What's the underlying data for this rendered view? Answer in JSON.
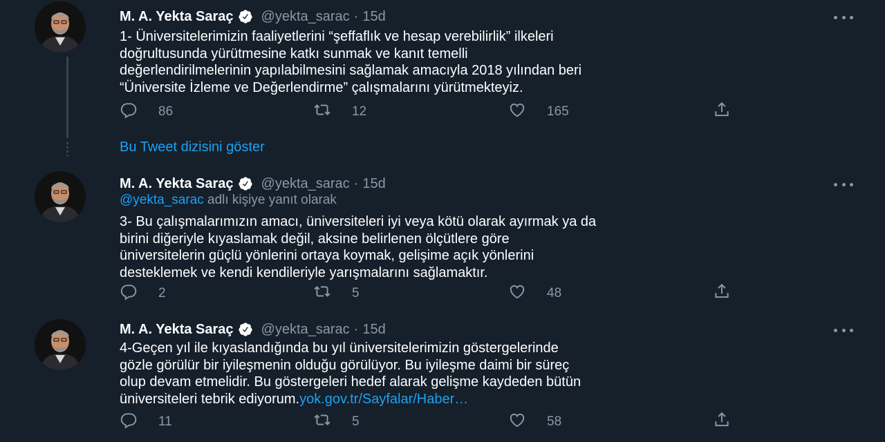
{
  "colors": {
    "background": "#15202b",
    "text": "#ffffff",
    "muted": "#8899a6",
    "accent": "#1da1f2",
    "thread_line": "#38444d"
  },
  "tweets": [
    {
      "name": "M. A. Yekta Saraç",
      "handle": "@yekta_sarac",
      "separator": "·",
      "time": "15d",
      "lines": [
        "1- Üniversitelerimizin faaliyetlerini “şeffaflık ve hesap verebilirlik” ilkeleri",
        "doğrultusunda yürütmesine katkı sunmak ve kanıt temelli",
        "değerlendirilmelerinin yapılabilmesini sağlamak amacıyla 2018 yılından beri",
        "“Üniversite İzleme ve Değerlendirme” çalışmalarını yürütmekteyiz."
      ],
      "replies": "86",
      "retweets": "12",
      "likes": "165"
    },
    {
      "name": "M. A. Yekta Saraç",
      "handle": "@yekta_sarac",
      "separator": "·",
      "time": "15d",
      "reply_mention": "@yekta_sarac",
      "reply_suffix": "adlı kişiye yanıt olarak",
      "lines": [
        "3- Bu çalışmalarımızın amacı, üniversiteleri iyi veya kötü olarak ayırmak ya da",
        "birini diğeriyle kıyaslamak değil, aksine belirlenen ölçütlere göre",
        "üniversitelerin güçlü yönlerini ortaya koymak, gelişime açık yönlerini",
        "desteklemek ve kendi kendileriyle yarışmalarını sağlamaktır."
      ],
      "replies": "2",
      "retweets": "5",
      "likes": "48"
    },
    {
      "name": "M. A. Yekta Saraç",
      "handle": "@yekta_sarac",
      "separator": "·",
      "time": "15d",
      "lines": [
        "4-Geçen yıl ile kıyaslandığında bu yıl üniversitelerimizin göstergelerinde",
        "gözle görülür bir iyileşmenin olduğu görülüyor. Bu iyileşme daimi bir süreç",
        "olup devam etmelidir. Bu göstergeleri hedef alarak gelişme kaydeden bütün"
      ],
      "last_line_text": "üniversiteleri tebrik ediyorum.",
      "last_line_link": "yok.gov.tr/Sayfalar/Haber…",
      "replies": "11",
      "retweets": "5",
      "likes": "58"
    }
  ],
  "thread_link": "Bu Tweet dizisini göster",
  "icons": [
    "avatar",
    "verified-badge-icon",
    "more-icon",
    "reply-icon",
    "retweet-icon",
    "like-icon",
    "share-icon"
  ]
}
